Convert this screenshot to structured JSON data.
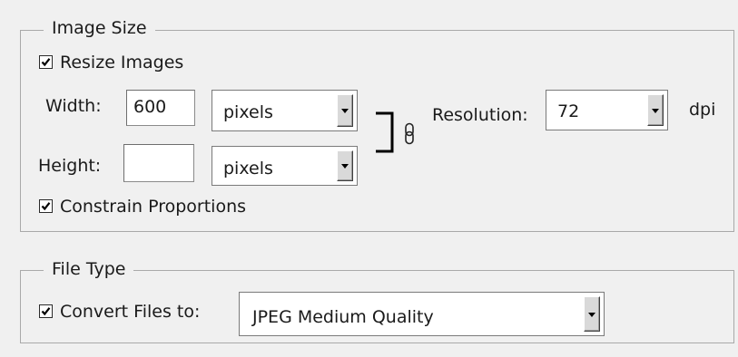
{
  "image_size": {
    "legend": "Image Size",
    "resize_images": {
      "label": "Resize Images",
      "checked": true
    },
    "width": {
      "label": "Width:",
      "value": "600",
      "unit": "pixels"
    },
    "height": {
      "label": "Height:",
      "value": "",
      "unit": "pixels"
    },
    "resolution": {
      "label": "Resolution:",
      "value": "72",
      "unit_label": "dpi"
    },
    "constrain_proportions": {
      "label": "Constrain Proportions",
      "checked": true
    }
  },
  "file_type": {
    "legend": "File Type",
    "convert_files": {
      "label": "Convert Files to:",
      "checked": true,
      "value": "JPEG Medium Quality"
    }
  },
  "icons": {
    "link": "chain-link-icon",
    "check": "checkmark-icon",
    "dropdown": "triangle-down-icon"
  }
}
